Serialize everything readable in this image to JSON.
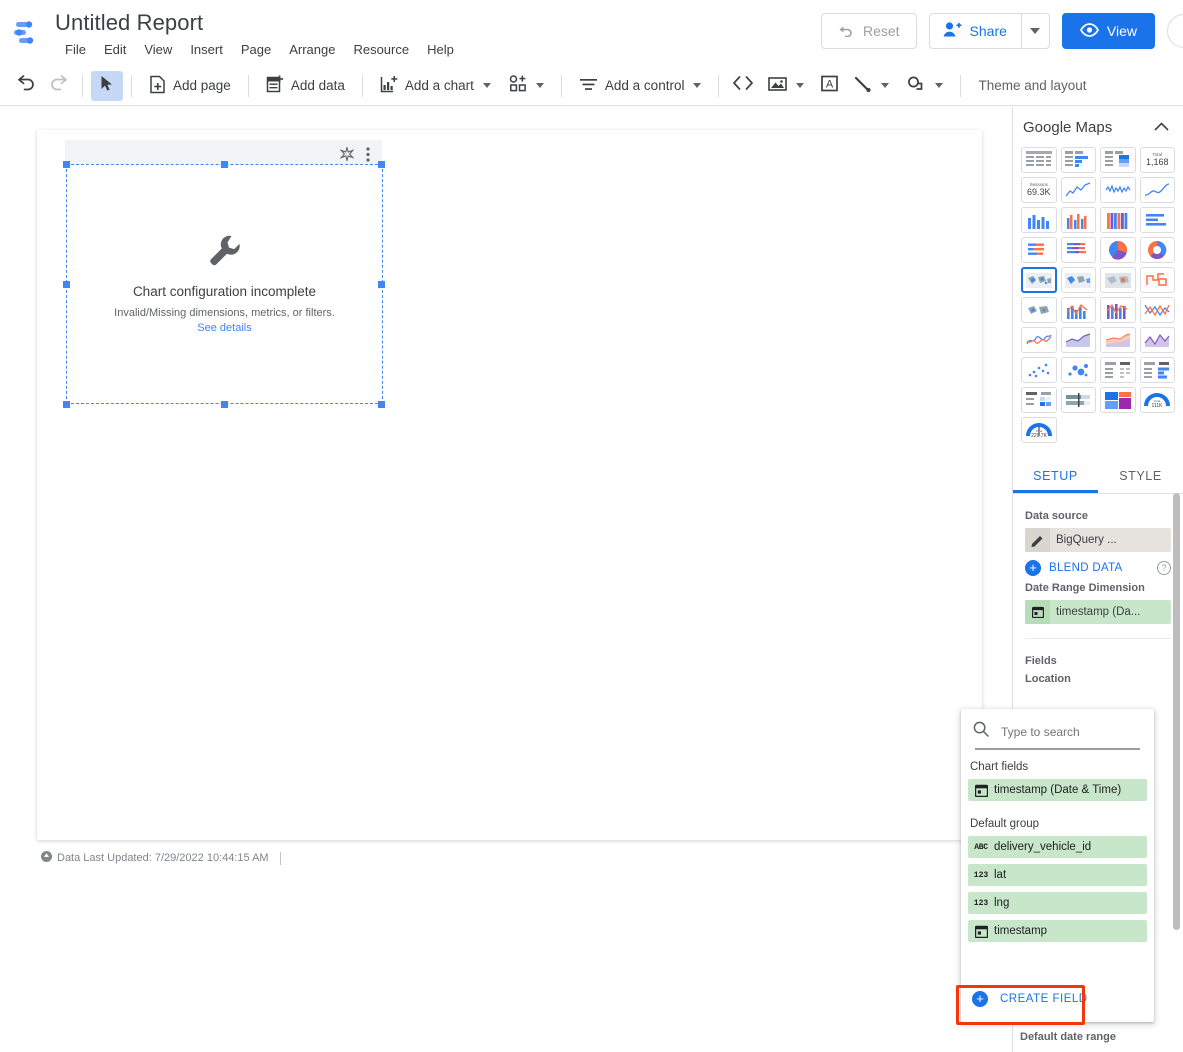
{
  "titlebar": {
    "logo_icon": "looker-studio-logo",
    "report_title": "Untitled Report",
    "menus": [
      {
        "label": "File"
      },
      {
        "label": "Edit"
      },
      {
        "label": "View"
      },
      {
        "label": "Insert"
      },
      {
        "label": "Page"
      },
      {
        "label": "Arrange"
      },
      {
        "label": "Resource"
      },
      {
        "label": "Help"
      }
    ],
    "reset_label": "Reset",
    "reset_icon": "undo-arrow-icon",
    "share_label": "Share",
    "share_icon": "person-add-icon",
    "share_caret_icon": "chevron-down-icon",
    "view_label": "View",
    "view_icon": "eye-icon",
    "avatar_icon": "user-avatar"
  },
  "toolbar": {
    "undo_icon": "undo-icon",
    "redo_icon": "redo-icon",
    "select_icon": "cursor-arrow-icon",
    "add_page_label": "Add page",
    "add_page_icon": "page-plus-icon",
    "add_data_label": "Add data",
    "add_data_icon": "database-plus-icon",
    "add_chart_label": "Add a chart",
    "add_chart_icon": "bar-chart-plus-icon",
    "community_viz_icon": "community-visualization-icon",
    "add_control_label": "Add a control",
    "add_control_icon": "filter-lines-icon",
    "embed_icon": "embed-code-icon",
    "image_icon": "image-icon",
    "textbox_icon": "text-box-icon",
    "line_icon": "line-tool-icon",
    "shape_icon": "shape-tool-icon",
    "theme_label": "Theme and layout"
  },
  "canvas": {
    "chart_header_icons": [
      "magic-wand-icon",
      "more-vert-icon"
    ],
    "placeholder": {
      "icon": "wrench-icon",
      "title": "Chart configuration incomplete",
      "subtitle": "Invalid/Missing dimensions, metrics, or filters.",
      "link": "See details"
    },
    "footer": {
      "icon": "refresh-circle-icon",
      "text": "Data Last Updated: 7/29/2022 10:44:15 AM"
    }
  },
  "right_panel": {
    "title": "Google Maps",
    "collapse_icon": "chevron-up-icon",
    "gallery": [
      {
        "name": "table",
        "labels": []
      },
      {
        "name": "table-with-bars",
        "labels": []
      },
      {
        "name": "table-with-heatmap",
        "labels": []
      },
      {
        "name": "scorecard",
        "labels": [
          "Total",
          "1,168"
        ]
      },
      {
        "name": "scorecard-compact",
        "labels": [
          "Sessions",
          "69.3K"
        ]
      },
      {
        "name": "time-series",
        "labels": []
      },
      {
        "name": "sparkline",
        "labels": []
      },
      {
        "name": "smoothed-time-series",
        "labels": []
      },
      {
        "name": "column-chart",
        "labels": []
      },
      {
        "name": "combo-chart",
        "labels": []
      },
      {
        "name": "stacked-column-chart",
        "labels": []
      },
      {
        "name": "bar-chart",
        "labels": []
      },
      {
        "name": "stacked-bar-chart",
        "labels": []
      },
      {
        "name": "grouped-bar-chart",
        "labels": []
      },
      {
        "name": "pie-chart",
        "labels": []
      },
      {
        "name": "donut-chart",
        "labels": []
      },
      {
        "name": "google-maps-bubble",
        "labels": [],
        "selected": true
      },
      {
        "name": "google-maps-filled",
        "labels": []
      },
      {
        "name": "geo-chart",
        "labels": []
      },
      {
        "name": "google-maps-heatmap",
        "labels": []
      },
      {
        "name": "geo-map-bubble",
        "labels": []
      },
      {
        "name": "combo-line-column",
        "labels": []
      },
      {
        "name": "stacked-combo",
        "labels": []
      },
      {
        "name": "line-chart-multi",
        "labels": []
      },
      {
        "name": "smoothed-line-chart",
        "labels": []
      },
      {
        "name": "area-chart",
        "labels": []
      },
      {
        "name": "stacked-area-chart",
        "labels": []
      },
      {
        "name": "area-chart-filled",
        "labels": []
      },
      {
        "name": "scatter-chart",
        "labels": []
      },
      {
        "name": "bubble-chart",
        "labels": []
      },
      {
        "name": "pivot-table",
        "labels": []
      },
      {
        "name": "pivot-table-bars",
        "labels": []
      },
      {
        "name": "pivot-table-heatmap",
        "labels": []
      },
      {
        "name": "bullet-chart",
        "labels": []
      },
      {
        "name": "treemap",
        "labels": []
      },
      {
        "name": "gauge-chart",
        "labels": [
          "Total",
          "111K"
        ]
      },
      {
        "name": "gauge-chart-alt",
        "labels": [
          "Total",
          "229.7K"
        ]
      }
    ],
    "tabs": [
      {
        "label": "SETUP",
        "active": true
      },
      {
        "label": "STYLE",
        "active": false
      }
    ],
    "setup": {
      "data_source_label": "Data source",
      "data_source_chip": {
        "icon": "pencil-icon",
        "text": "BigQuery ..."
      },
      "blend_data_label": "BLEND DATA",
      "blend_plus_icon": "plus-circle-icon",
      "help_icon": "help-circle-icon",
      "date_range_dim_label": "Date Range Dimension",
      "date_range_chip": {
        "icon": "calendar-icon",
        "text": "timestamp (Da..."
      },
      "fields_label": "Fields",
      "location_label": "Location",
      "default_date_range_label": "Default date range"
    }
  },
  "field_picker": {
    "search_icon": "search-icon",
    "search_placeholder": "Type to search",
    "search_value": "",
    "groups": [
      {
        "label": "Chart fields",
        "items": [
          {
            "icon": "calendar-icon",
            "type": "date",
            "label": "timestamp (Date & Time)"
          }
        ]
      },
      {
        "label": "Default group",
        "items": [
          {
            "icon": "abc-icon",
            "type": "text",
            "label": "delivery_vehicle_id"
          },
          {
            "icon": "123-icon",
            "type": "number",
            "label": "lat"
          },
          {
            "icon": "123-icon",
            "type": "number",
            "label": "lng"
          },
          {
            "icon": "calendar-icon",
            "type": "date",
            "label": "timestamp"
          }
        ]
      }
    ],
    "create_field_label": "CREATE FIELD",
    "create_field_icon": "plus-circle-icon"
  },
  "colors": {
    "accent_blue": "#1a73e8",
    "field_green": "#c8e6c9",
    "chip_grey": "#e6e2dd",
    "highlight_red": "#f4360b"
  }
}
